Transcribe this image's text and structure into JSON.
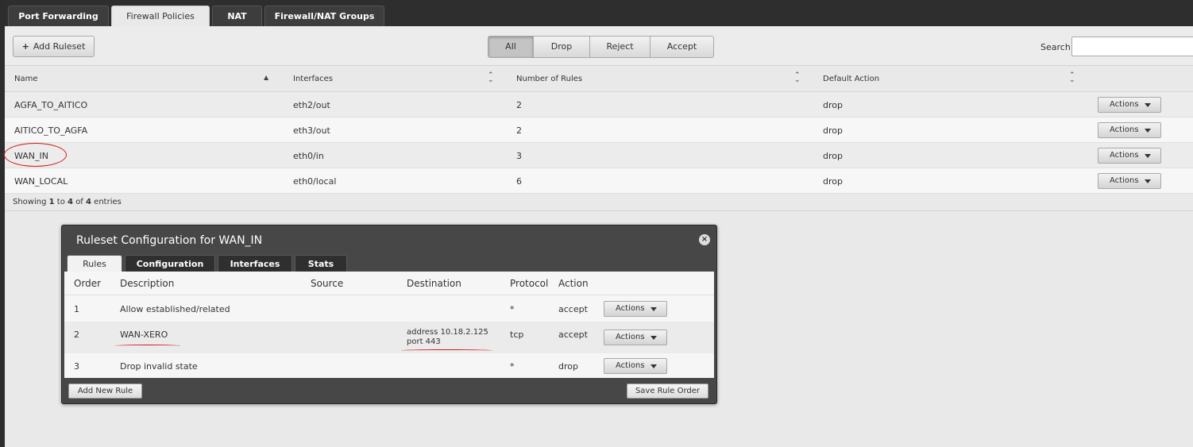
{
  "top_tabs": [
    "Port Forwarding",
    "Firewall Policies",
    "NAT",
    "Firewall/NAT Groups"
  ],
  "toolbar": {
    "add_ruleset": "Add Ruleset",
    "filters": [
      "All",
      "Drop",
      "Reject",
      "Accept"
    ],
    "active_filter": "All",
    "search_label": "Search",
    "search_value": ""
  },
  "table": {
    "headers": [
      "Name",
      "Interfaces",
      "Number of Rules",
      "Default Action"
    ],
    "rows": [
      {
        "name": "AGFA_TO_AITICO",
        "interfaces": "eth2/out",
        "rules": "2",
        "action": "drop",
        "button": "Actions"
      },
      {
        "name": "AITICO_TO_AGFA",
        "interfaces": "eth3/out",
        "rules": "2",
        "action": "drop",
        "button": "Actions"
      },
      {
        "name": "WAN_IN",
        "interfaces": "eth0/in",
        "rules": "3",
        "action": "drop",
        "button": "Actions"
      },
      {
        "name": "WAN_LOCAL",
        "interfaces": "eth0/local",
        "rules": "6",
        "action": "drop",
        "button": "Actions"
      }
    ],
    "entries": {
      "prefix": "Showing",
      "from": "1",
      "to_word": "to",
      "to": "4",
      "of_word": "of",
      "total": "4",
      "suffix": "entries"
    }
  },
  "dialog": {
    "title": "Ruleset Configuration for WAN_IN",
    "close_icon": "×",
    "tabs": [
      "Rules",
      "Configuration",
      "Interfaces",
      "Stats"
    ],
    "active_tab": "Rules",
    "headers": [
      "Order",
      "Description",
      "Source",
      "Destination",
      "Protocol",
      "Action"
    ],
    "rows": [
      {
        "order": "1",
        "description": "Allow established/related",
        "source": "",
        "destination_line1": "",
        "destination_line2": "",
        "protocol": "*",
        "action": "accept",
        "button": "Actions"
      },
      {
        "order": "2",
        "description": "WAN-XERO",
        "source": "",
        "destination_line1": "address 10.18.2.125",
        "destination_line2": "port 443",
        "protocol": "tcp",
        "action": "accept",
        "button": "Actions"
      },
      {
        "order": "3",
        "description": "Drop invalid state",
        "source": "",
        "destination_line1": "",
        "destination_line2": "",
        "protocol": "*",
        "action": "drop",
        "button": "Actions"
      }
    ],
    "add_rule": "Add New Rule",
    "save_order": "Save Rule Order"
  },
  "colors": {
    "annotation": "#d21a1a",
    "tabbar": "#2e2e2e",
    "dialog": "#474747"
  }
}
